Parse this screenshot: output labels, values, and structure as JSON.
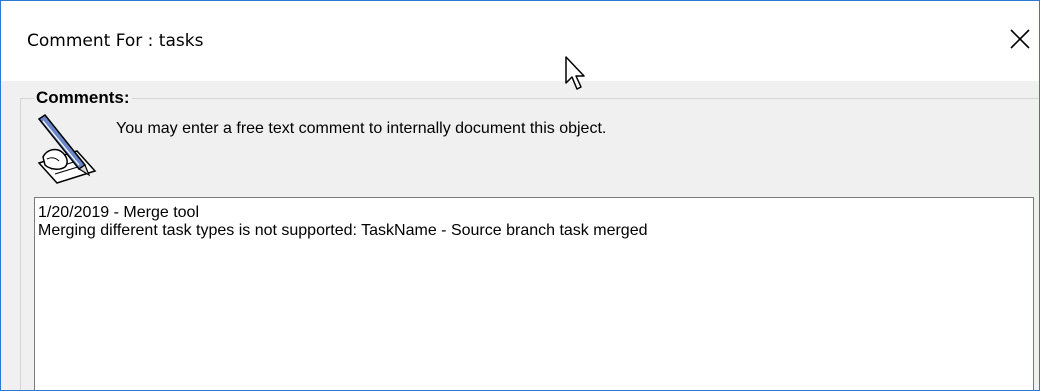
{
  "window": {
    "title": "Comment For : tasks"
  },
  "comments_group": {
    "label": "Comments:",
    "hint": "You may enter a free text comment to internally document this object.",
    "icon": "pen-writing-icon"
  },
  "comment_editor": {
    "lines": [
      "1/20/2019 - Merge tool",
      "Merging different task types is not supported: TaskName - Source branch task merged"
    ]
  },
  "icons": {
    "close": "close-icon",
    "cursor": "mouse-pointer-icon"
  },
  "colors": {
    "window_border": "#2b79d4",
    "dialog_background": "#f0f0f0",
    "editor_border": "#7a7a7a"
  }
}
